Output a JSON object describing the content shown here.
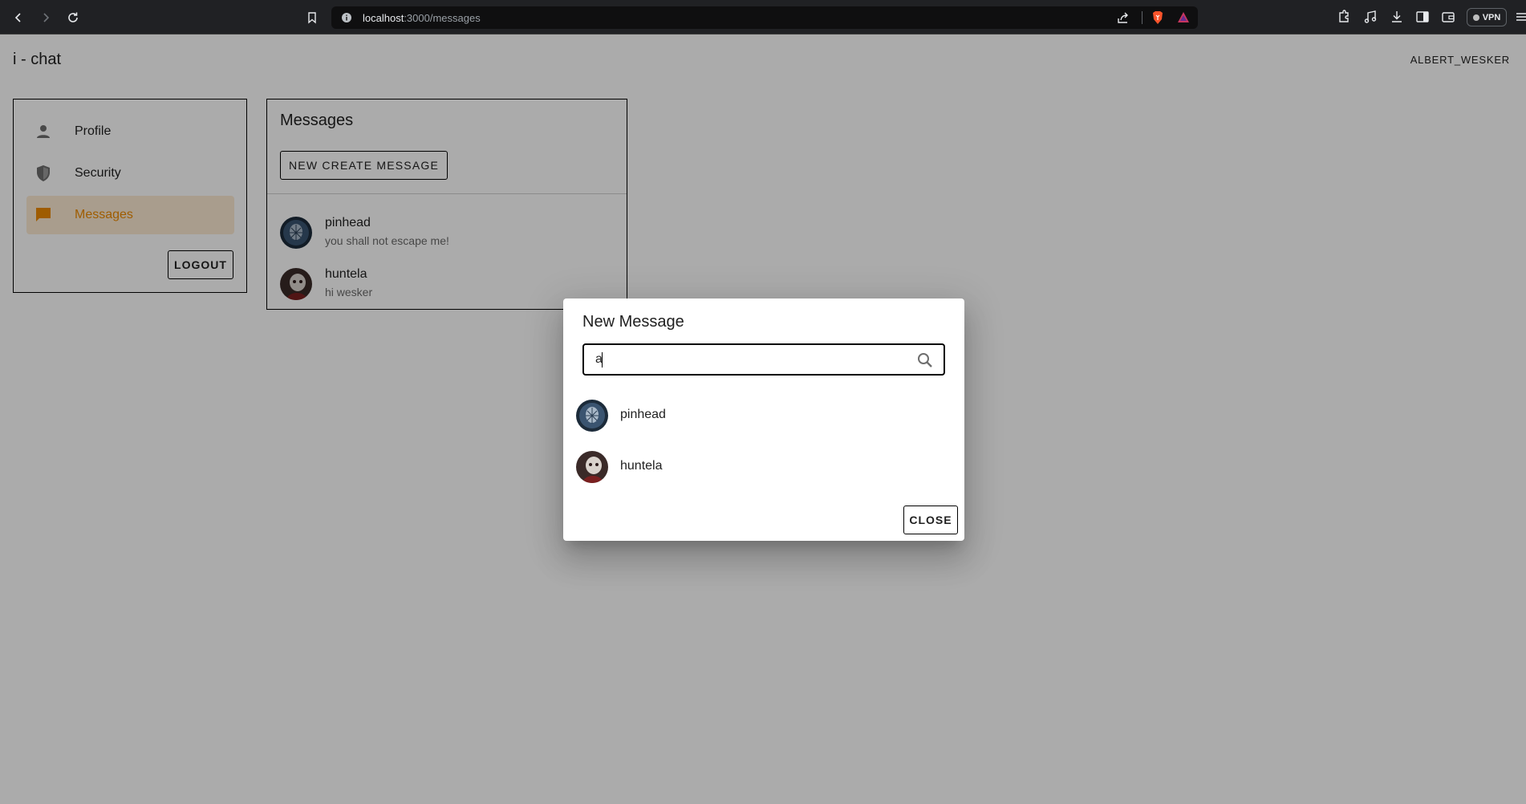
{
  "browser": {
    "url_host": "localhost",
    "url_path": ":3000/messages",
    "vpn_label": "VPN"
  },
  "app": {
    "title": "i - chat",
    "username": "ALBERT_WESKER"
  },
  "sidebar": {
    "items": [
      {
        "label": "Profile",
        "icon": "person-icon"
      },
      {
        "label": "Security",
        "icon": "shield-icon"
      },
      {
        "label": "Messages",
        "icon": "chat-icon",
        "active": true
      }
    ],
    "logout_label": "LOGOUT"
  },
  "messages": {
    "title": "Messages",
    "new_button_label": "NEW CREATE MESSAGE",
    "conversations": [
      {
        "name": "pinhead",
        "preview": "you shall not escape me!"
      },
      {
        "name": "huntela",
        "preview": "hi wesker"
      }
    ]
  },
  "dialog": {
    "title": "New Message",
    "search_value": "a",
    "results": [
      {
        "name": "pinhead"
      },
      {
        "name": "huntela"
      }
    ],
    "close_label": "CLOSE"
  },
  "colors": {
    "accent": "#ed8a00",
    "active_bg": "#fdebd3",
    "backdrop": "rgba(0,0,0,0.33)"
  }
}
